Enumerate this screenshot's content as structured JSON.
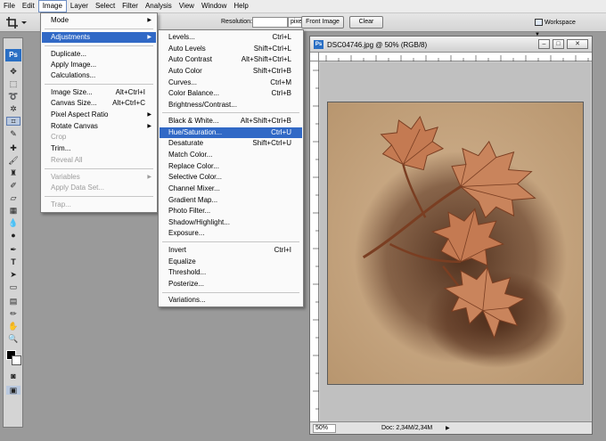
{
  "menubar": {
    "items": [
      "File",
      "Edit",
      "Image",
      "Layer",
      "Select",
      "Filter",
      "Analysis",
      "View",
      "Window",
      "Help"
    ],
    "active": "Image"
  },
  "optionsbar": {
    "resolution_label": "Resolution:",
    "resolution_value": "",
    "units_value": "pixels/inch",
    "front_image_label": "Front Image",
    "clear_label": "Clear",
    "workspace_label": "Workspace"
  },
  "toolbox": {
    "logo": "Ps"
  },
  "image_menu": {
    "items": [
      {
        "label": "Mode",
        "shortcut": "",
        "submenu": true
      },
      {
        "label": "Adjustments",
        "shortcut": "",
        "submenu": true,
        "highlighted": true
      },
      {
        "label": "Duplicate...",
        "shortcut": ""
      },
      {
        "label": "Apply Image...",
        "shortcut": ""
      },
      {
        "label": "Calculations...",
        "shortcut": ""
      },
      {
        "label": "Image Size...",
        "shortcut": "Alt+Ctrl+I"
      },
      {
        "label": "Canvas Size...",
        "shortcut": "Alt+Ctrl+C"
      },
      {
        "label": "Pixel Aspect Ratio",
        "shortcut": "",
        "submenu": true
      },
      {
        "label": "Rotate Canvas",
        "shortcut": "",
        "submenu": true
      },
      {
        "label": "Crop",
        "shortcut": "",
        "disabled": true
      },
      {
        "label": "Trim...",
        "shortcut": ""
      },
      {
        "label": "Reveal All",
        "shortcut": "",
        "disabled": true
      },
      {
        "label": "Variables",
        "shortcut": "",
        "submenu": true,
        "disabled": true
      },
      {
        "label": "Apply Data Set...",
        "shortcut": "",
        "disabled": true
      },
      {
        "label": "Trap...",
        "shortcut": "",
        "disabled": true
      }
    ]
  },
  "adjustments_menu": {
    "items": [
      {
        "label": "Levels...",
        "shortcut": "Ctrl+L"
      },
      {
        "label": "Auto Levels",
        "shortcut": "Shift+Ctrl+L"
      },
      {
        "label": "Auto Contrast",
        "shortcut": "Alt+Shift+Ctrl+L"
      },
      {
        "label": "Auto Color",
        "shortcut": "Shift+Ctrl+B"
      },
      {
        "label": "Curves...",
        "shortcut": "Ctrl+M"
      },
      {
        "label": "Color Balance...",
        "shortcut": "Ctrl+B"
      },
      {
        "label": "Brightness/Contrast...",
        "shortcut": ""
      },
      {
        "label": "Black & White...",
        "shortcut": "Alt+Shift+Ctrl+B"
      },
      {
        "label": "Hue/Saturation...",
        "shortcut": "Ctrl+U",
        "highlighted": true
      },
      {
        "label": "Desaturate",
        "shortcut": "Shift+Ctrl+U"
      },
      {
        "label": "Match Color...",
        "shortcut": ""
      },
      {
        "label": "Replace Color...",
        "shortcut": ""
      },
      {
        "label": "Selective Color...",
        "shortcut": ""
      },
      {
        "label": "Channel Mixer...",
        "shortcut": ""
      },
      {
        "label": "Gradient Map...",
        "shortcut": ""
      },
      {
        "label": "Photo Filter...",
        "shortcut": ""
      },
      {
        "label": "Shadow/Highlight...",
        "shortcut": ""
      },
      {
        "label": "Exposure...",
        "shortcut": ""
      },
      {
        "label": "Invert",
        "shortcut": "Ctrl+I"
      },
      {
        "label": "Equalize",
        "shortcut": ""
      },
      {
        "label": "Threshold...",
        "shortcut": ""
      },
      {
        "label": "Posterize...",
        "shortcut": ""
      },
      {
        "label": "Variations...",
        "shortcut": ""
      }
    ]
  },
  "document": {
    "title": "DSC04746.jpg @ 50% (RGB/8)",
    "zoom": "50%",
    "doc_info": "Doc: 2,34M/2,34M",
    "colors": {
      "paper": "#c9a784",
      "leaf": "#b5603c",
      "shadow": "#5a3420"
    }
  }
}
